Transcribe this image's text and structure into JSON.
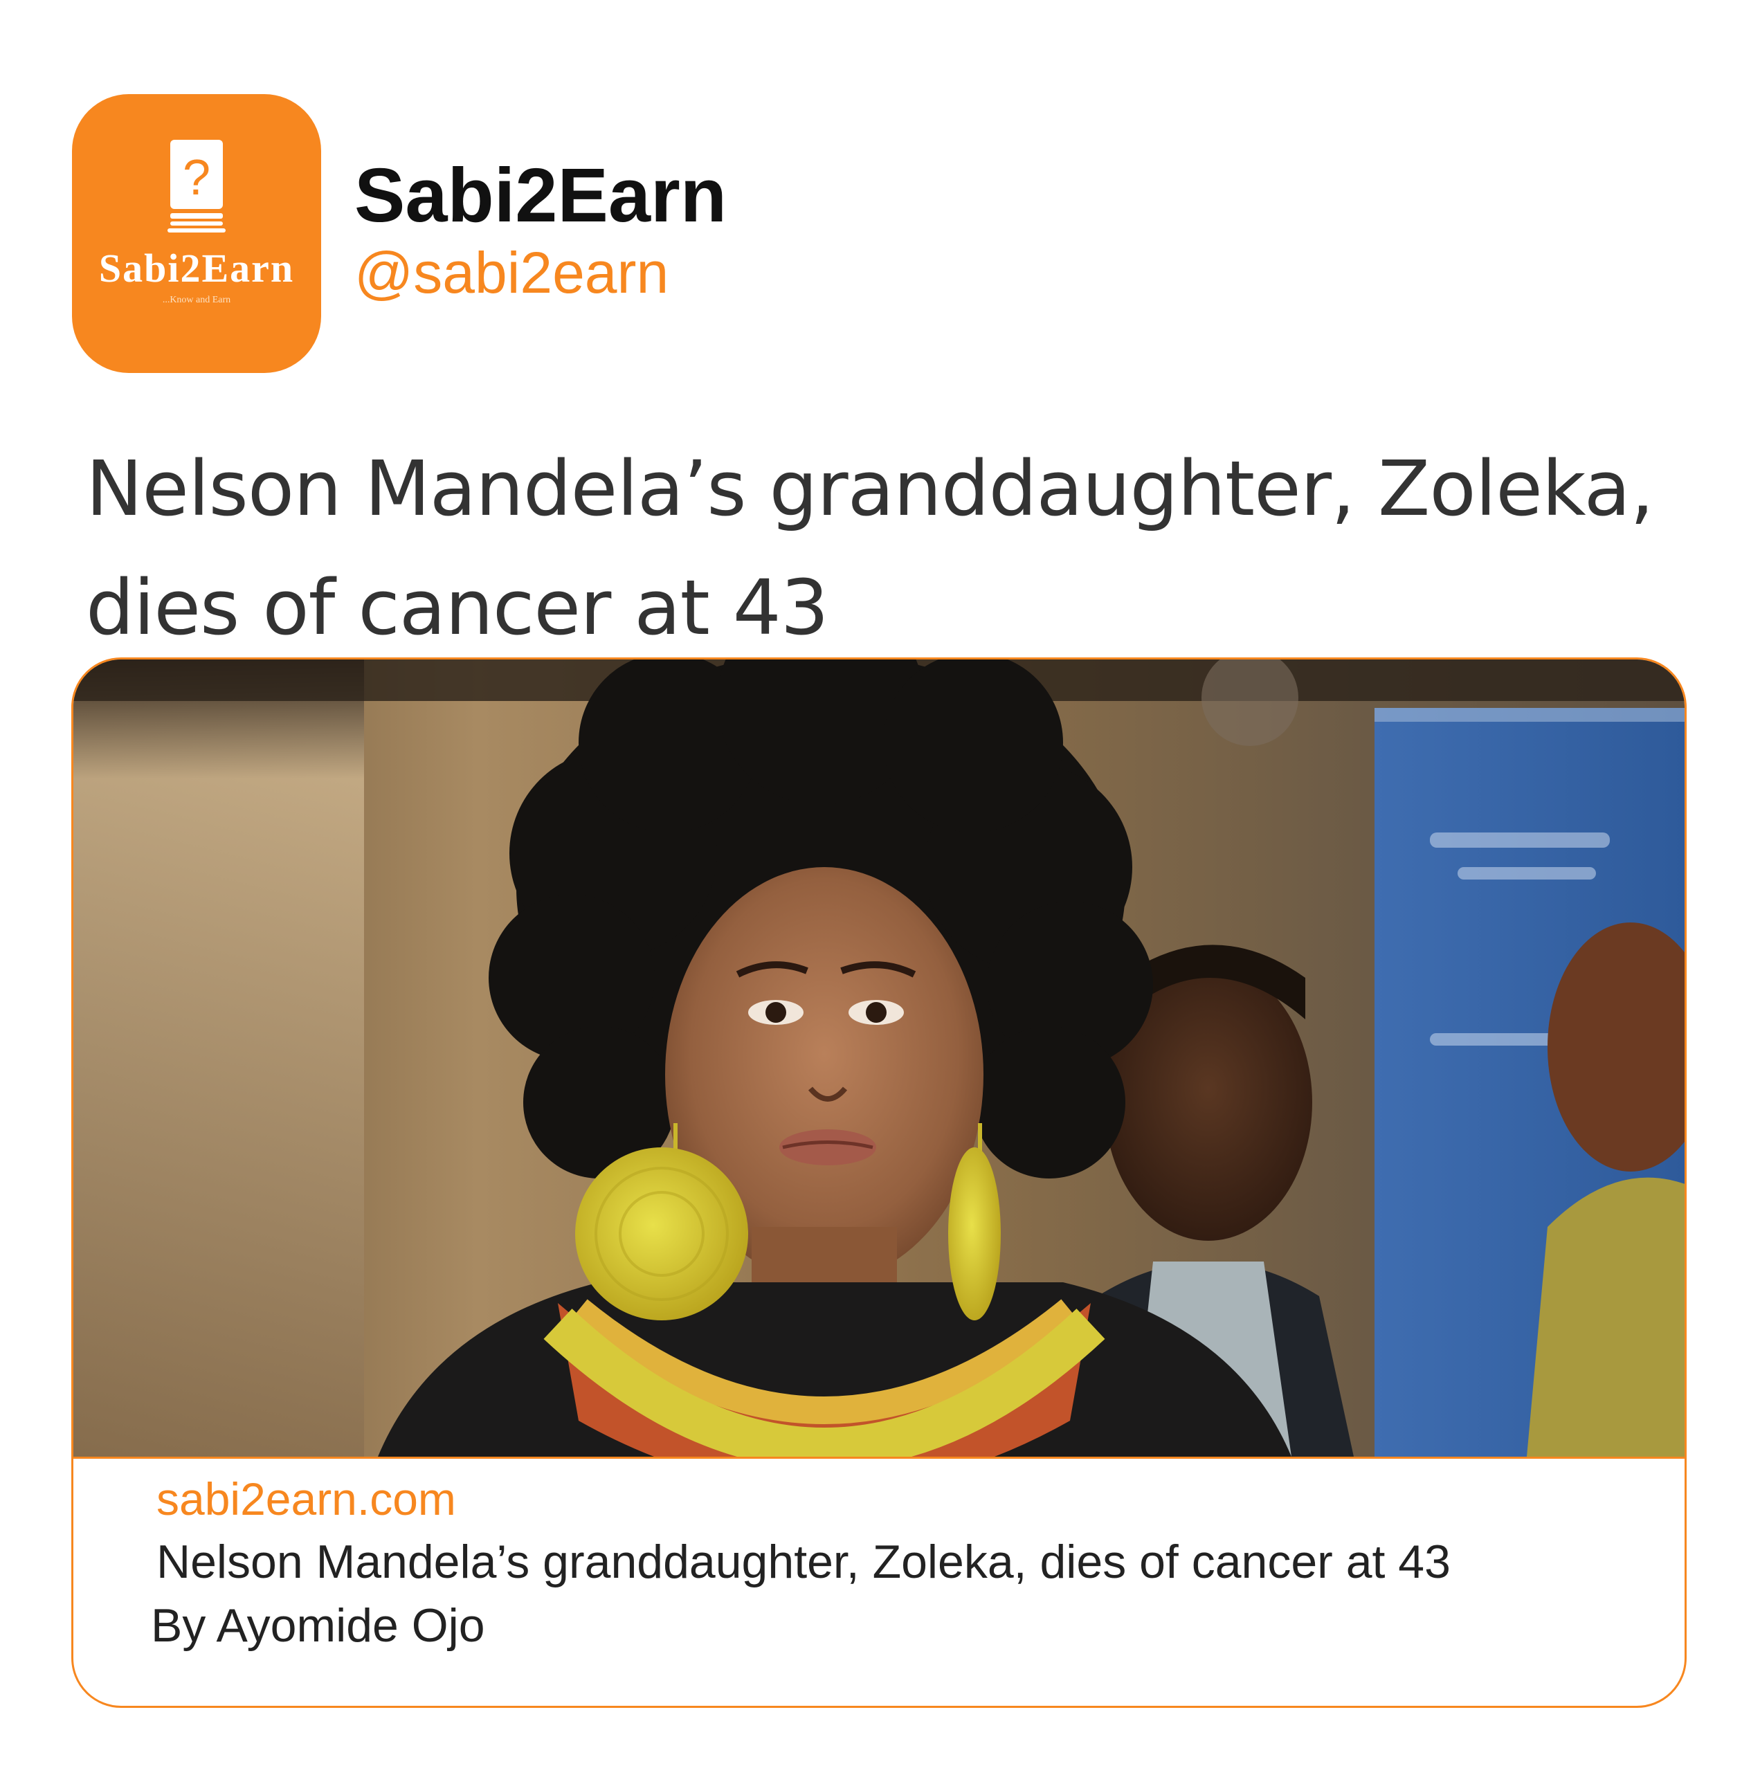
{
  "account": {
    "avatar_icon": "question-book-icon",
    "avatar_wordmark": "Sabi2Earn",
    "avatar_tagline": "...Know and Earn",
    "name": "Sabi2Earn",
    "handle": "@sabi2earn"
  },
  "post": {
    "headline": "Nelson Mandela’s granddaughter, Zoleka, dies of cancer at 43"
  },
  "link_card": {
    "domain": "sabi2earn.com",
    "title": "Nelson Mandela’s granddaughter, Zoleka, dies of cancer at 43",
    "byline": "By Ayomide Ojo"
  },
  "colors": {
    "brand": "#f7871f",
    "text": "#333333",
    "background": "#ffffff"
  }
}
